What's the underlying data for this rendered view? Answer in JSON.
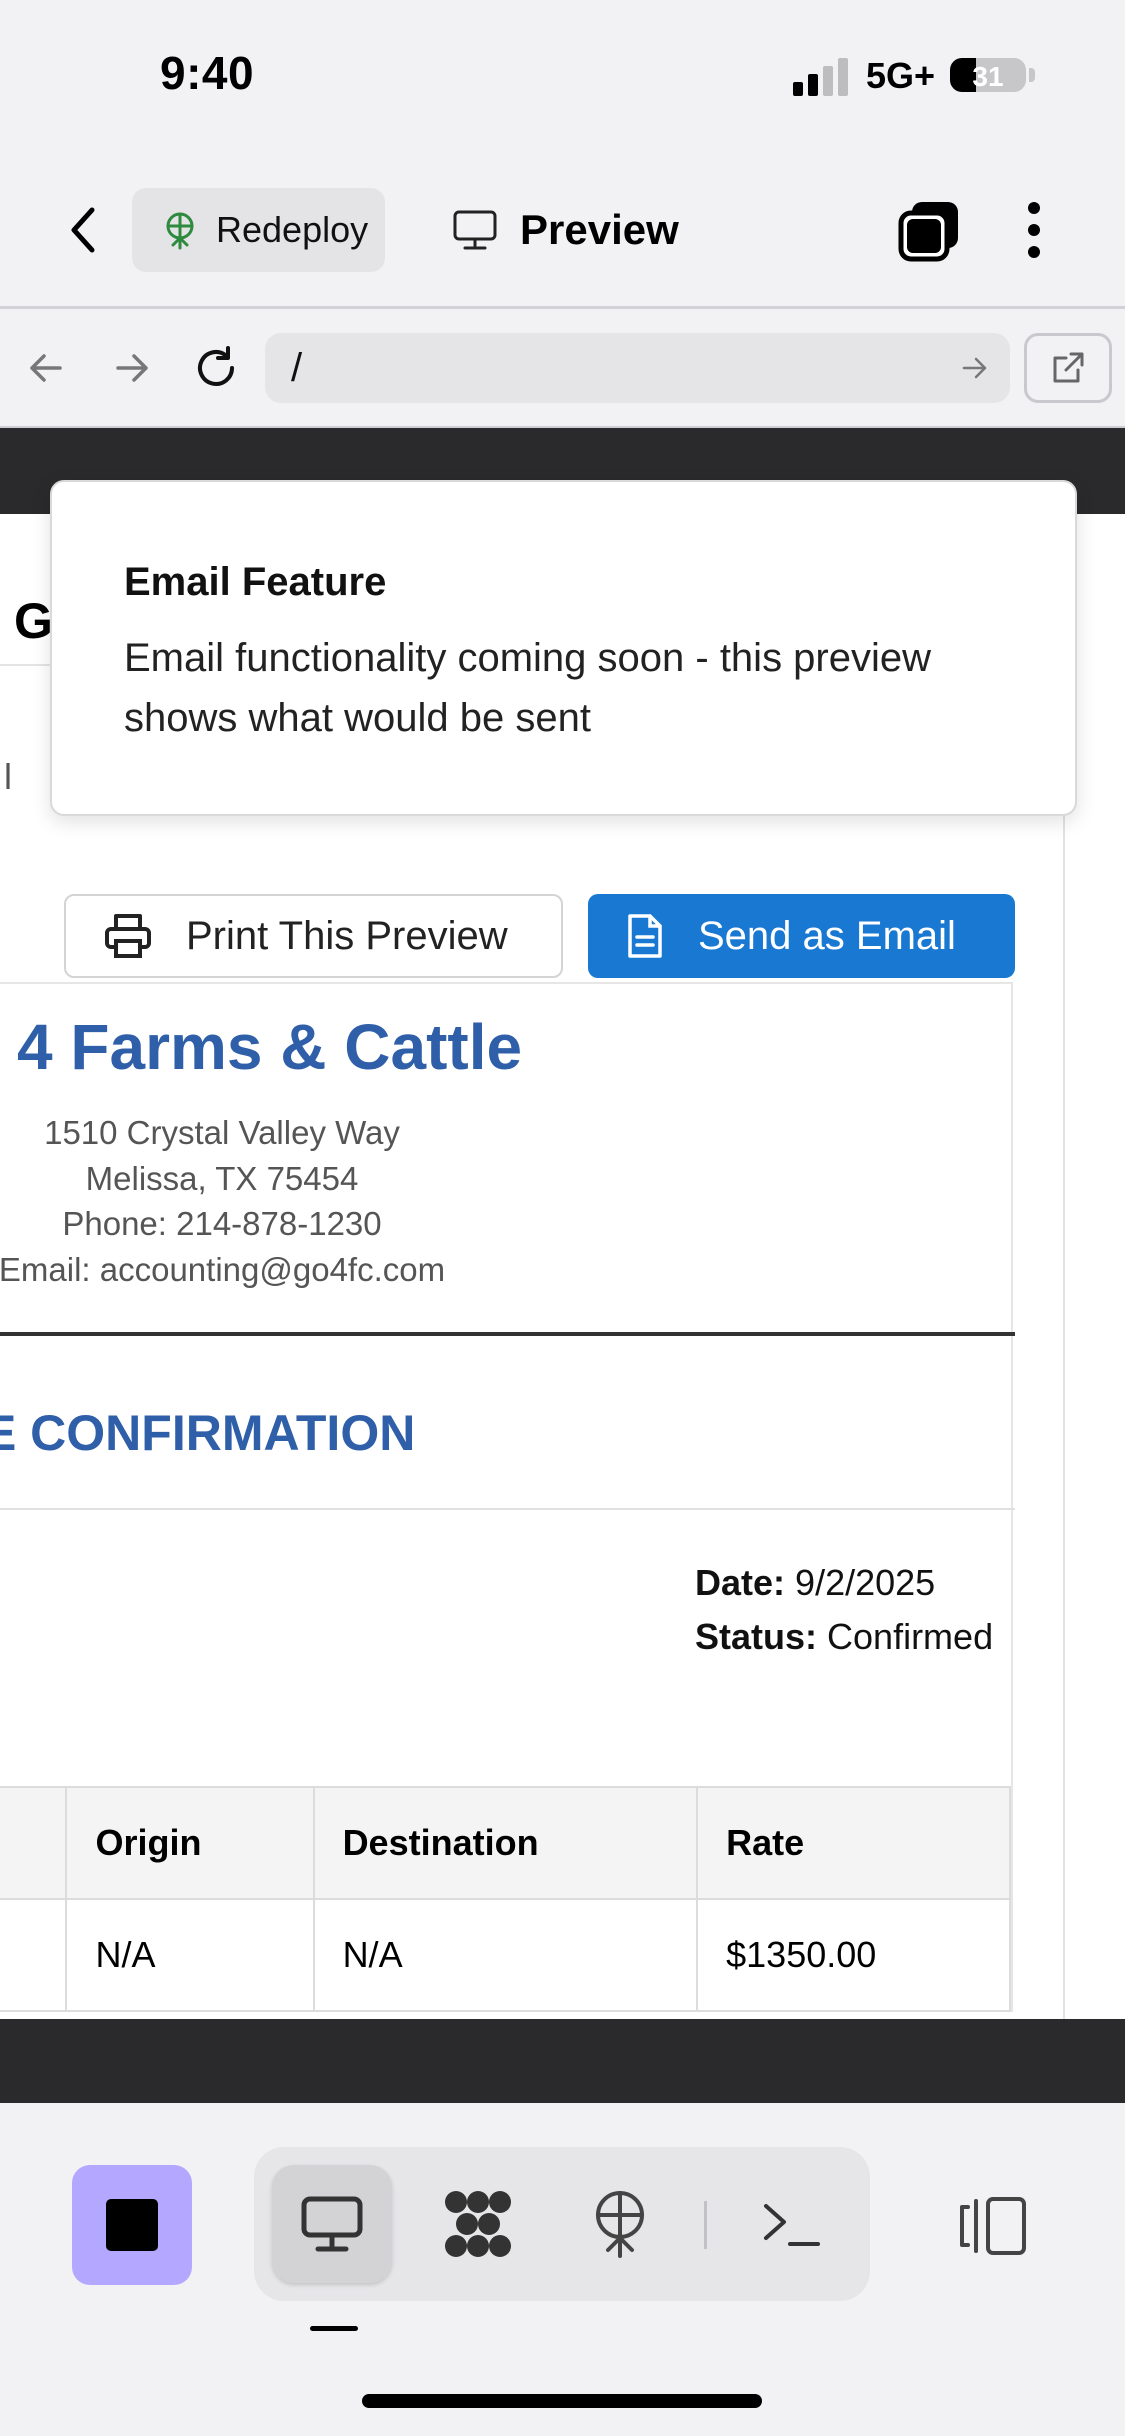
{
  "status_bar": {
    "time": "9:40",
    "network": "5G+",
    "battery": "31"
  },
  "toolbar": {
    "back_icon": "chevron-left-icon",
    "redeploy_label": "Redeploy",
    "preview_label": "Preview",
    "tabs_icon": "tabs-icon",
    "more_icon": "more-vertical-icon"
  },
  "browser": {
    "url": "/"
  },
  "preview": {
    "print_label": "Print This Preview",
    "send_label": "Send as Email",
    "company": {
      "name": "4 Farms & Cattle",
      "address_line1": "1510 Crystal Valley Way",
      "address_line2": "Melissa, TX 75454",
      "phone": "Phone: 214-878-1230",
      "email": "Email: accounting@go4fc.com"
    },
    "doc_title": "ATE CONFIRMATION",
    "date_label": "Date:",
    "date_value": "9/2/2025",
    "status_label": "Status:",
    "status_value": "Confirmed",
    "table": {
      "headers": [
        "Origin",
        "Destination",
        "Rate"
      ],
      "rows": [
        [
          "N/A",
          "N/A",
          "$1350.00"
        ]
      ]
    },
    "partial_left_letters": {
      "header": "G",
      "bar": "l"
    }
  },
  "toast": {
    "title": "Email Feature",
    "message": "Email functionality coming soon - this preview shows what would be sent"
  },
  "bottom_bar": {
    "items": [
      "desktop-icon",
      "packages-icon",
      "deploy-icon",
      "terminal-icon"
    ],
    "right_icon": "split-panel-icon"
  },
  "colors": {
    "accent": "#1878d2",
    "brand_blue": "#2f5fa8",
    "stop_button": "#b3a7ff"
  }
}
